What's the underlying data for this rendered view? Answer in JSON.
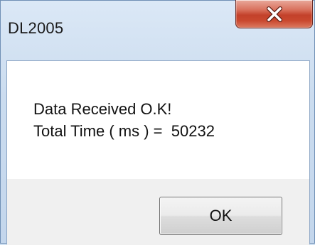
{
  "window": {
    "title": "DL2005"
  },
  "titlebar": {
    "close_icon": "close-icon",
    "close_button_color": "#c9492f"
  },
  "message": {
    "line1": "Data Received O.K!",
    "line2": "Total Time ( ms ) =  50232"
  },
  "buttons": {
    "ok_label": "OK"
  }
}
